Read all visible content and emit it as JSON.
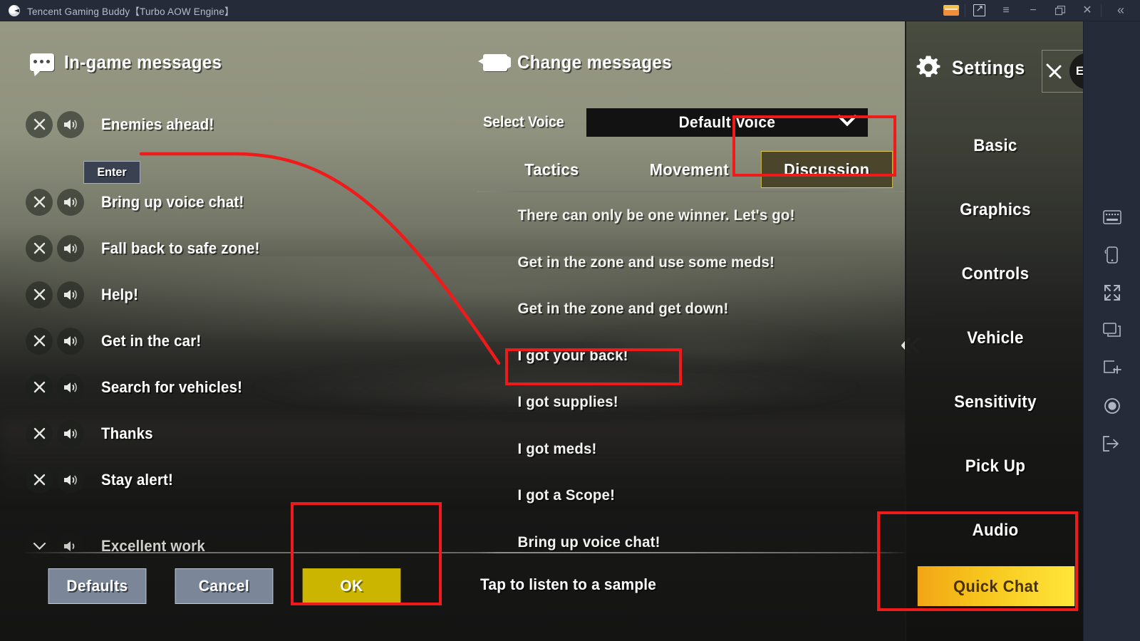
{
  "titlebar": {
    "app_title": "Tencent Gaming Buddy【Turbo AOW Engine】",
    "logo_icon": "tencent-gaming-buddy-logo",
    "buttons": [
      {
        "name": "wallet-icon",
        "label": ""
      },
      {
        "name": "popout-icon",
        "label": ""
      },
      {
        "name": "menu-icon",
        "label": "≡"
      },
      {
        "name": "minimize-icon",
        "label": "−"
      },
      {
        "name": "maximize-icon",
        "label": ""
      },
      {
        "name": "close-icon",
        "label": "✕"
      },
      {
        "name": "collapse-sidebar-icon",
        "label": "«"
      }
    ]
  },
  "left_panel": {
    "title": "In-game messages",
    "icon": "speech-bubble-icon",
    "enter_button": "Enter",
    "messages": [
      "Enemies ahead!",
      "Bring up voice chat!",
      "Fall back to safe zone!",
      "Help!",
      "Get in the car!",
      "Search for vehicles!",
      "Thanks",
      "Stay alert!"
    ],
    "last_message": "Excellent work",
    "buttons": {
      "defaults": "Defaults",
      "cancel": "Cancel",
      "ok": "OK"
    }
  },
  "center_panel": {
    "title": "Change messages",
    "icon": "change-messages-icon",
    "select_voice_label": "Select Voice",
    "selected_voice": "Default Voice",
    "voice_options": [
      "Default Voice"
    ],
    "tabs": [
      {
        "label": "Tactics",
        "active": false
      },
      {
        "label": "Movement",
        "active": false
      },
      {
        "label": "Discussion",
        "active": true
      }
    ],
    "messages": [
      {
        "text": "There can only be one winner. Let's go!",
        "highlighted": false
      },
      {
        "text": "Get in the zone and use some meds!",
        "highlighted": false
      },
      {
        "text": "Get in the zone and get down!",
        "highlighted": false
      },
      {
        "text": "I got your back!",
        "highlighted": false
      },
      {
        "text": "I got supplies!",
        "highlighted": true
      },
      {
        "text": "I got meds!",
        "highlighted": false
      },
      {
        "text": "I got a Scope!",
        "highlighted": false
      },
      {
        "text": "Bring up voice chat!",
        "highlighted": false
      }
    ],
    "sample_hint": "Tap to listen to a sample",
    "collapse_arrows": "«"
  },
  "settings_panel": {
    "title": "Settings",
    "gear_icon": "gear-icon",
    "close_label": "Esc",
    "items": [
      "Basic",
      "Graphics",
      "Controls",
      "Vehicle",
      "Sensitivity",
      "Pick Up",
      "Audio"
    ],
    "quick_chat_button": "Quick Chat"
  },
  "emulator_toolbar": {
    "icons": [
      "keyboard-icon",
      "rotate-device-icon",
      "fullscreen-icon",
      "multi-window-icon",
      "new-instance-icon",
      "record-icon",
      "exit-icon"
    ]
  },
  "annotations": {
    "accent_color": "#f01a1a",
    "boxes": [
      "discussion-tab",
      "i-got-supplies-message",
      "ok-button",
      "quick-chat-button"
    ],
    "curve": "enter-button-to-i-got-supplies"
  },
  "colors": {
    "titlebar_bg": "#262b3a",
    "ok_button": "#cbb500",
    "quick_chat_start": "#f2a616",
    "quick_chat_end": "#ffe63a",
    "active_tab_border": "#e0c84c",
    "annotation_red": "#f01a1a"
  }
}
